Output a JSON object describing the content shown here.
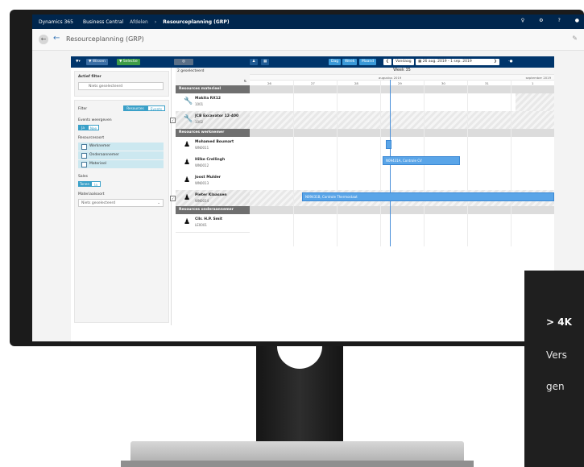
{
  "app": {
    "brand": "Dynamics 365",
    "product": "Business Central",
    "breadcrumb_parent": "Afdelen",
    "breadcrumb_current": "Resourceplanning (GRP)"
  },
  "page": {
    "title": "Resourceplanning (GRP)"
  },
  "toolbar": {
    "filter_label": "",
    "wissen_label": "Wissen",
    "selectie_label": "Selectie",
    "day_label": "Dag",
    "week_label": "Week",
    "month_label": "Maand",
    "vandaag_label": "Vandaag",
    "date_range": "26 aug. 2019 - 1 sep. 2019"
  },
  "left": {
    "active_filter_title": "Actief filter",
    "active_filter_value": "Niets geselecteerd",
    "filter_label": "Filter",
    "resources_label": "Resources",
    "events_label": "Events",
    "events_show_label": "Events weergeven",
    "ja_label": "Ja",
    "nee_label": "Nee",
    "resource_type_label": "Resourcesoort",
    "types": [
      "Werknemer",
      "Onderaannemer",
      "Materieel"
    ],
    "sales_label": "Sales",
    "tonen_label": "Tonen",
    "ja2_label": "Ja",
    "material_type_label": "Materiaalsoort",
    "material_value": "Niets geselecteerd"
  },
  "grid": {
    "selected_count": "2 geselecteerd",
    "week_title": "Week 35",
    "month_left": "augustus 2019",
    "month_right": "september 2019",
    "days": [
      "26",
      "27",
      "28",
      "29",
      "30",
      "31",
      "1"
    ],
    "groups": {
      "materieel": "Resources materieel",
      "werknemer": "Resources werknemer",
      "onderaannemer": "Resources onderaannemer"
    },
    "resources": [
      {
        "name": "Makita RX12",
        "code": "1001"
      },
      {
        "name": "JCB Excavator 12-400",
        "code": "1002"
      },
      {
        "name": "Mohamed Boumart",
        "code": "WN0011"
      },
      {
        "name": "Hilke Crellingh",
        "code": "WN0012"
      },
      {
        "name": "Joost Mulder",
        "code": "WN0013"
      },
      {
        "name": "Pieter Klaassen",
        "code": "WN0014"
      },
      {
        "name": "Cllr. H.P. Smit",
        "code": "LE0001"
      }
    ],
    "bars": [
      {
        "label": "N09431A, Controle CV"
      },
      {
        "label": "N09431B, Controle Thermostaat"
      }
    ]
  },
  "overlay": {
    "line1": "> 4K",
    "line2": "Vers",
    "line3": "gen"
  }
}
